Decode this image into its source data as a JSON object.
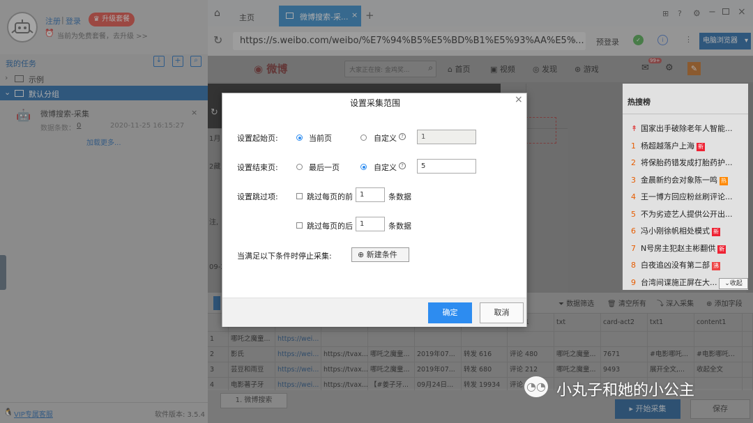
{
  "sidebar": {
    "register": "注册",
    "sep": "|",
    "login": "登录",
    "upgrade": "升级套餐",
    "free_note": "当前为免费套餐，去升级 >>",
    "tasks_title": "我的任务",
    "groups": [
      {
        "label": "示例"
      },
      {
        "label": "默认分组"
      }
    ],
    "task": {
      "name": "微博搜索-采集",
      "count_label": "数据条数：",
      "count": "0",
      "time": "2020-11-25 16:15:27"
    },
    "load_more": "加载更多...",
    "vip": "VIP专属客服",
    "version": "软件版本: 3.5.4"
  },
  "tabs": {
    "home": "主页",
    "active": "微博搜索-采...",
    "add": "+"
  },
  "address": {
    "url": "https://s.weibo.com/weibo/%E7%94%B5%E5%BD%B1%E5%93%AA%E5%...",
    "login": "预登录",
    "browser": "电脑浏览器"
  },
  "weibo": {
    "logo": "微博",
    "search_placeholder": "大家正在搜: 金鸡奖...",
    "nav": [
      "首页",
      "视频",
      "发现",
      "游戏"
    ],
    "badge": "99+",
    "hot_title": "热搜榜",
    "hot": [
      {
        "rank": "",
        "text": "国家出手破除老年人智能..."
      },
      {
        "rank": "1",
        "text": "杨超越落户上海",
        "tag": "新"
      },
      {
        "rank": "2",
        "text": "将保胎药错发成打胎药护..."
      },
      {
        "rank": "3",
        "text": "金晨新约会对象陈一鸣",
        "tag": "热"
      },
      {
        "rank": "4",
        "text": "王一博方回应粉丝刷评论..."
      },
      {
        "rank": "5",
        "text": "不为劣迹艺人提供公开出..."
      },
      {
        "rank": "6",
        "text": "冯小刚徐帆相处模式",
        "tag": "新"
      },
      {
        "rank": "7",
        "text": "N号房主犯赵主彬翻供",
        "tag": "新"
      },
      {
        "rank": "8",
        "text": "白夜追凶没有第二部",
        "tag": "沸"
      },
      {
        "rank": "9",
        "text": "台湾间谍施正屏在大..."
      }
    ],
    "collapse": "收起",
    "fragments": [
      "1月",
      "2藏",
      "注,",
      "09-2"
    ]
  },
  "dialog": {
    "title": "设置采集范围",
    "start_label": "设置起始页:",
    "current_page": "当前页",
    "custom": "自定义",
    "start_value": "1",
    "end_label": "设置结束页:",
    "last_page": "最后一页",
    "end_value": "5",
    "skip_label": "设置跳过项:",
    "skip_front": "跳过每页的前",
    "skip_front_value": "1",
    "skip_back": "跳过每页的后",
    "skip_back_value": "1",
    "items": "条数据",
    "stop_label": "当满足以下条件时停止采集:",
    "new_condition": "新建条件",
    "ok": "确定",
    "cancel": "取消",
    "help": "?"
  },
  "toolbar": {
    "filter": "数据筛选",
    "clear": "清空所有",
    "deep": "深入采集",
    "add_field": "添加字段"
  },
  "table": {
    "headers": [
      "",
      "",
      "",
      "",
      "",
      "",
      "",
      "t-act1",
      "txt",
      "card-act2",
      "txt1",
      "content1",
      ""
    ],
    "rows": [
      [
        "1",
        "哪吒之魔童...",
        "https://wei...",
        "",
        "",
        "",
        "",
        "",
        "",
        "",
        "",
        "",
        ""
      ],
      [
        "2",
        "影氏",
        "https://wei...",
        "https://tvax...",
        "哪吒之魔童...",
        "2019年07...",
        "转发 616",
        "评论 480",
        "哪吒之魔童...",
        "7671",
        "#电影哪吒...",
        "#电影哪吒...",
        ""
      ],
      [
        "3",
        "芸豆和雨豆",
        "https://wei...",
        "https://tvax...",
        "哪吒之魔童...",
        "2019年07...",
        "转发 680",
        "评论 212",
        "哪吒之魔童...",
        "9493",
        "展开全文,...",
        "收起全文",
        ""
      ],
      [
        "4",
        "电影著子牙",
        "https://wei...",
        "https://tvax...",
        "【#姜子牙...",
        "09月24日...",
        "转发 19934",
        "评论 ...",
        "",
        "",
        "",
        "",
        ""
      ]
    ]
  },
  "bottom": {
    "sheet_tab": "1. 微博搜索",
    "start": "开始采集",
    "save": "保存"
  },
  "watermark": "小丸子和她的小公主"
}
